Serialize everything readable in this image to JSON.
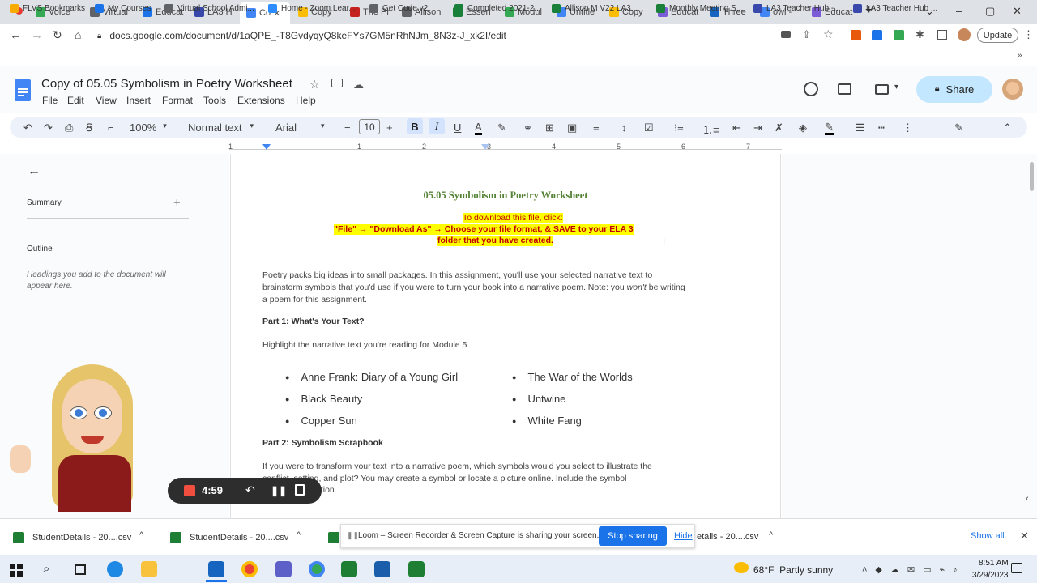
{
  "tabs": [
    {
      "label": "Voice",
      "color": "#34a853"
    },
    {
      "label": "Virtual",
      "color": "#5f6368"
    },
    {
      "label": "Educat",
      "color": "#1a73e8"
    },
    {
      "label": "LA3 H",
      "color": "#3949ab"
    },
    {
      "label": "Co",
      "color": "#4285f4",
      "active": true
    },
    {
      "label": "Copy",
      "color": "#fbbc04"
    },
    {
      "label": "The Pr",
      "color": "#c5221f"
    },
    {
      "label": "Allison",
      "color": "#5f6368"
    },
    {
      "label": "Essen",
      "color": "#188038"
    },
    {
      "label": "Modul",
      "color": "#34a853"
    },
    {
      "label": "Untitle",
      "color": "#4285f4"
    },
    {
      "label": "Copy",
      "color": "#fbbc04"
    },
    {
      "label": "Educat",
      "color": "#7b5cd6"
    },
    {
      "label": "Three",
      "color": "#1565c0"
    },
    {
      "label": "owl -",
      "color": "#4285f4"
    },
    {
      "label": "Educat",
      "color": "#7b5cd6"
    }
  ],
  "address": {
    "url": "docs.google.com/document/d/1aQPE_-T8GvdyqyQ8keFYs7GM5nRhNJm_8N3z-J_xk2I/edit",
    "update_label": "Update"
  },
  "bookmarks": [
    {
      "label": "FLVS Bookmarks",
      "color": "#f9ab00"
    },
    {
      "label": "My Courses",
      "color": "#1a73e8"
    },
    {
      "label": "Virtual School Admi...",
      "color": "#5f6368"
    },
    {
      "label": "Home - Zoom Lear...",
      "color": "#2d8cff"
    },
    {
      "label": "Get Code v2",
      "color": "#5f6368"
    },
    {
      "label": "Completed 2021-2...",
      "color": "#188038"
    },
    {
      "label": "Allison M V22 LA3...",
      "color": "#188038"
    },
    {
      "label": "Monthly Meeting S...",
      "color": "#188038"
    },
    {
      "label": "LA3 Teacher Hub -...",
      "color": "#3949ab"
    },
    {
      "label": "LA3 Teacher Hub ...",
      "color": "#3949ab"
    }
  ],
  "doc": {
    "title": "Copy of 05.05 Symbolism in Poetry Worksheet",
    "menus": [
      "File",
      "Edit",
      "View",
      "Insert",
      "Format",
      "Tools",
      "Extensions",
      "Help"
    ],
    "share_label": "Share"
  },
  "toolbar": {
    "zoom": "100%",
    "style": "Normal text",
    "font": "Arial",
    "size": "10"
  },
  "ruler": [
    "1",
    "1",
    "2",
    "3",
    "4",
    "5",
    "6",
    "7"
  ],
  "sidebar": {
    "summary": "Summary",
    "outline": "Outline",
    "hint": "Headings you add to the document will appear here."
  },
  "page": {
    "heading": "05.05 Symbolism in Poetry Worksheet",
    "dl_line1": "To download this file, click:",
    "dl_line2": "\"File\" → \"Download As\" → Choose your file format, & SAVE to your ELA 3",
    "dl_line3": "folder that you have created.",
    "intro1": "Poetry packs big ideas into small packages. In this assignment, you'll use your selected narrative text to",
    "intro2a": "brainstorm symbols that you'd use if you were to turn your book into a narrative poem. Note: you ",
    "intro2b": "won't",
    "intro2c": " be writing",
    "intro3": "a poem for this assignment.",
    "part1": "Part 1: What's Your Text?",
    "highlight": "Highlight the narrative text you're reading for Module 5",
    "books_left": [
      "Anne Frank: Diary of a Young Girl",
      "Black Beauty",
      "Copper Sun"
    ],
    "books_right": [
      "The War of the Worlds",
      "Untwine",
      "White Fang"
    ],
    "part2": "Part 2: Symbolism Scrapbook",
    "p2line1": "If you were to transform your text into a narrative poem, which symbols would you select to illustrate the",
    "p2line2": "conflict, setting, and plot? You may create a symbol or locate a picture online.  Include the symbol",
    "p2line3": "ation."
  },
  "recorder": {
    "time": "4:59"
  },
  "downloads": {
    "items": [
      "StudentDetails - 20....csv",
      "StudentDetails - 20....csv",
      "etails - 20....csv"
    ],
    "sharing_text": "Loom – Screen Recorder & Screen Capture is sharing your screen.",
    "stop_label": "Stop sharing",
    "hide_label": "Hide",
    "show_all": "Show all"
  },
  "taskbar": {
    "weather": "68°F  Partly sunny",
    "time": "8:51 AM",
    "date": "3/29/2023"
  }
}
